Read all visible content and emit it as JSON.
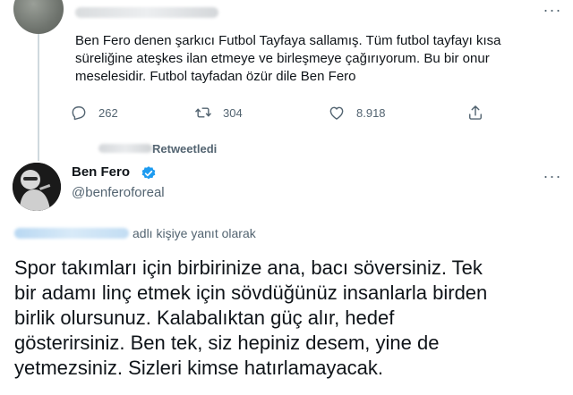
{
  "quoted_tweet": {
    "more_label": "···",
    "text": "Ben Fero denen şarkıcı  Futbol Tayfaya sallamış. Tüm futbol tayfayı kısa\nsüreliğine ateşkes ilan etmeye ve birleşmeye çağırıyorum. Bu bir onur\nmeselesidir. Futbol tayfadan özür dile Ben Fero",
    "actions": {
      "reply_count": "262",
      "retweet_count": "304",
      "like_count": "8.918"
    }
  },
  "retweet_label": "Retweetledi",
  "main_tweet": {
    "author_name": "Ben Fero",
    "author_handle": "@benferoforeal",
    "more_label": "···",
    "reply_to_suffix": "adlı kişiye yanıt olarak",
    "text": "Spor takımları için birbirinize ana, bacı söversiniz. Tek\nbir adamı linç etmek için sövdüğünüz insanlarla birden\nbirlik olursunuz. Kalabalıktan güç alır, hedef\ngösterirsiniz. Ben tek, siz hepiniz desem, yine de\nyetmezsiniz. Sizleri kimse hatırlamayacak."
  },
  "colors": {
    "text_primary": "#0f1419",
    "text_secondary": "#536471",
    "verified_blue": "#1d9bf0",
    "thread_line": "#cfd9de"
  },
  "icons": [
    "reply-icon",
    "retweet-icon",
    "like-icon",
    "share-icon",
    "verified-badge-icon",
    "more-icon"
  ]
}
